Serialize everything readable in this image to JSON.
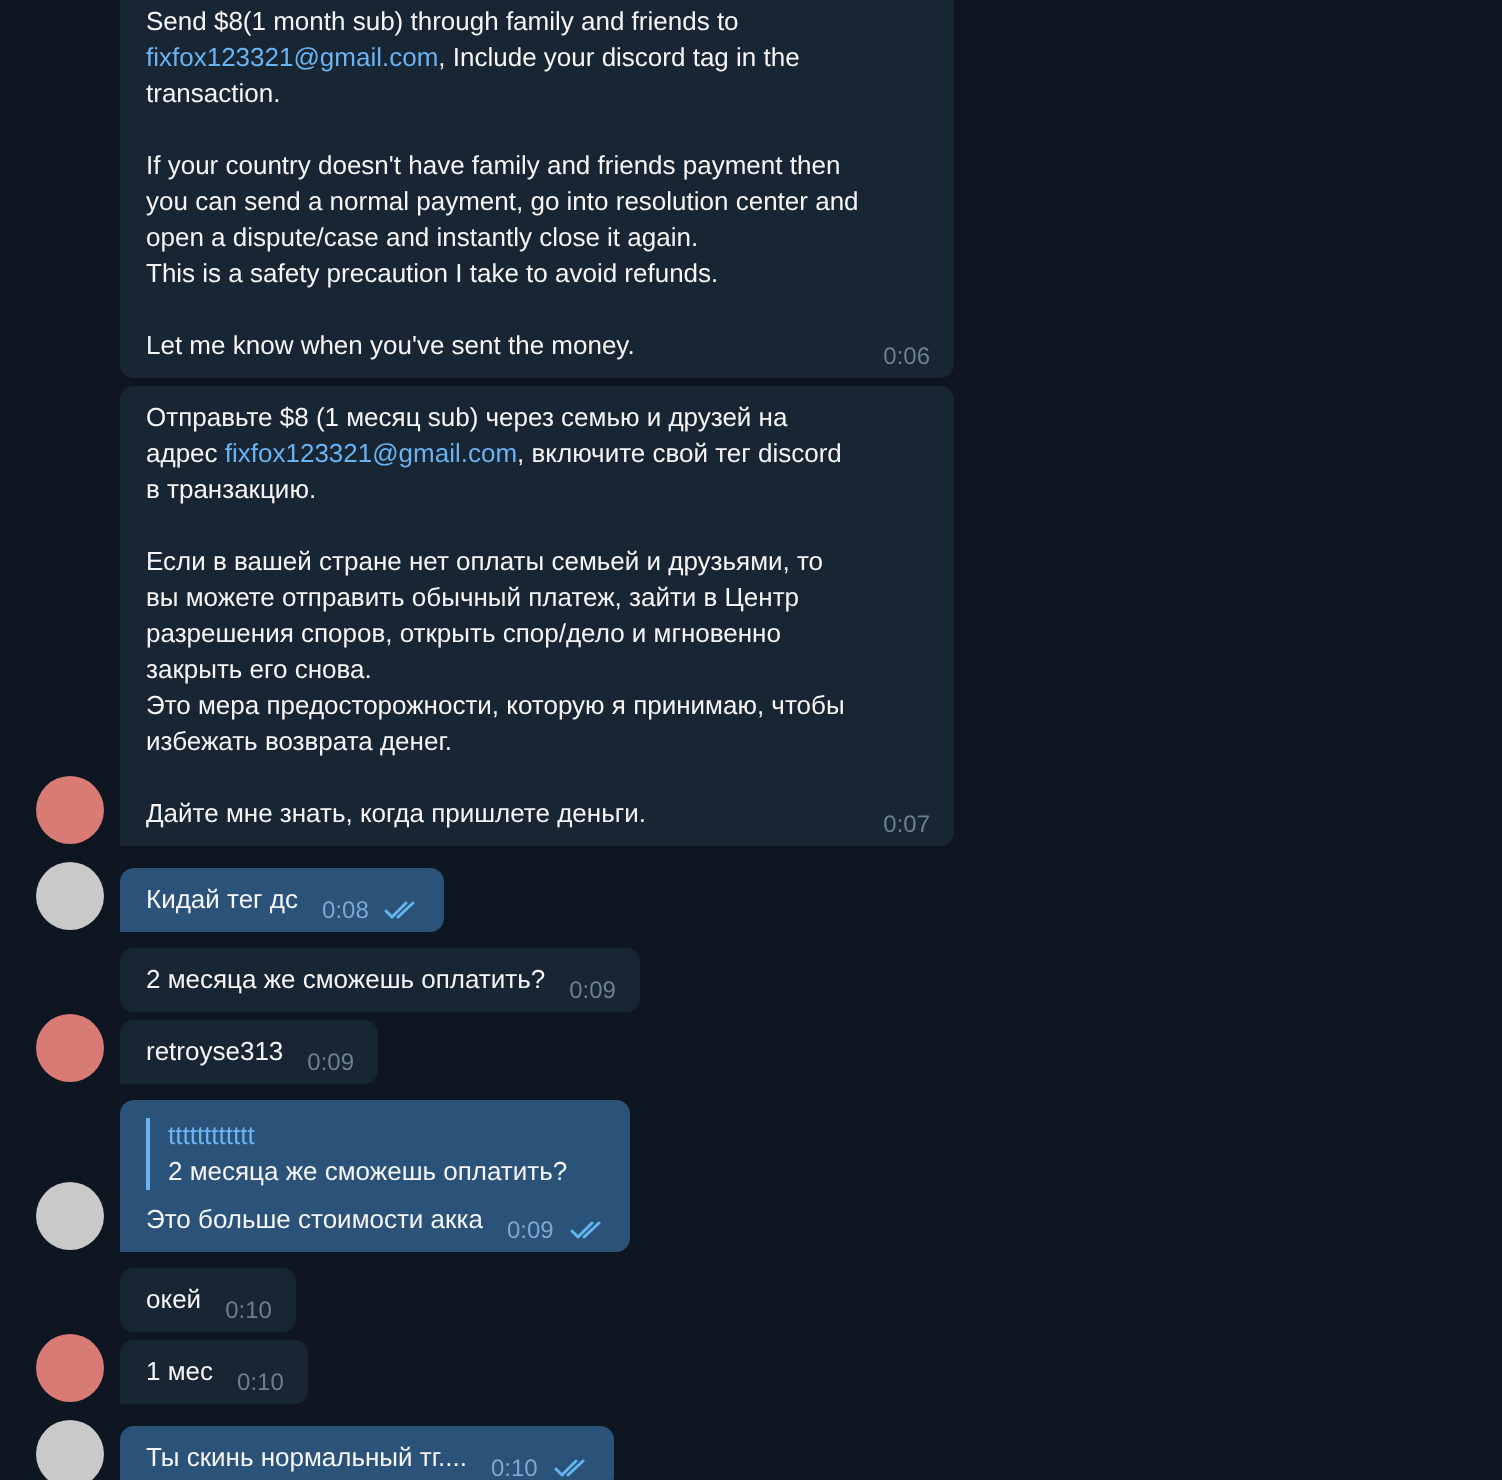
{
  "groups": [
    {
      "kind": "incoming",
      "messages": [
        {
          "parts": [
            {
              "text": "Send $8(1 month sub) through family and friends to "
            },
            {
              "text": "fixfox123321@gmail.com",
              "link": true
            },
            {
              "text": ", Include your discord tag in the transaction.\n\nIf your country doesn't have family and friends payment then you can send a normal payment, go into resolution center and open a dispute/case and instantly close it again.\nThis is a safety precaution I take to avoid refunds.\n\nLet me know when you've sent the money."
            }
          ],
          "time": "0:06"
        },
        {
          "parts": [
            {
              "text": "Отправьте $8 (1 месяц sub) через семью и друзей на адрес "
            },
            {
              "text": "fixfox123321@gmail.com",
              "link": true
            },
            {
              "text": ", включите свой тег discord в транзакцию.\n\nЕсли в вашей стране нет оплаты семьей и друзьями, то вы можете отправить обычный платеж, зайти в Центр разрешения споров, открыть спор/дело и мгновенно закрыть его снова.\nЭто мера предосторожности, которую я принимаю, чтобы избежать возврата денег.\n\nДайте мне знать, когда пришлете деньги."
            }
          ],
          "time": "0:07"
        }
      ]
    },
    {
      "kind": "outgoing",
      "messages": [
        {
          "parts": [
            {
              "text": "Кидай тег дс"
            }
          ],
          "time": "0:08",
          "read": true
        }
      ]
    },
    {
      "kind": "incoming",
      "messages": [
        {
          "parts": [
            {
              "text": "2 месяца же сможешь оплатить?"
            }
          ],
          "time": "0:09"
        },
        {
          "parts": [
            {
              "text": "retroyse313"
            }
          ],
          "time": "0:09"
        }
      ]
    },
    {
      "kind": "outgoing",
      "messages": [
        {
          "reply": {
            "author": "tttttttttttt",
            "text": "2 месяца же сможешь оплатить?"
          },
          "parts": [
            {
              "text": "Это больше стоимости акка"
            }
          ],
          "time": "0:09",
          "read": true
        }
      ]
    },
    {
      "kind": "incoming",
      "messages": [
        {
          "parts": [
            {
              "text": "окей"
            }
          ],
          "time": "0:10"
        },
        {
          "parts": [
            {
              "text": "1 мес"
            }
          ],
          "time": "0:10"
        }
      ]
    },
    {
      "kind": "outgoing",
      "messages": [
        {
          "parts": [
            {
              "text": "Ты скинь нормальный тг...."
            }
          ],
          "time": "0:10",
          "read": true
        }
      ]
    }
  ]
}
